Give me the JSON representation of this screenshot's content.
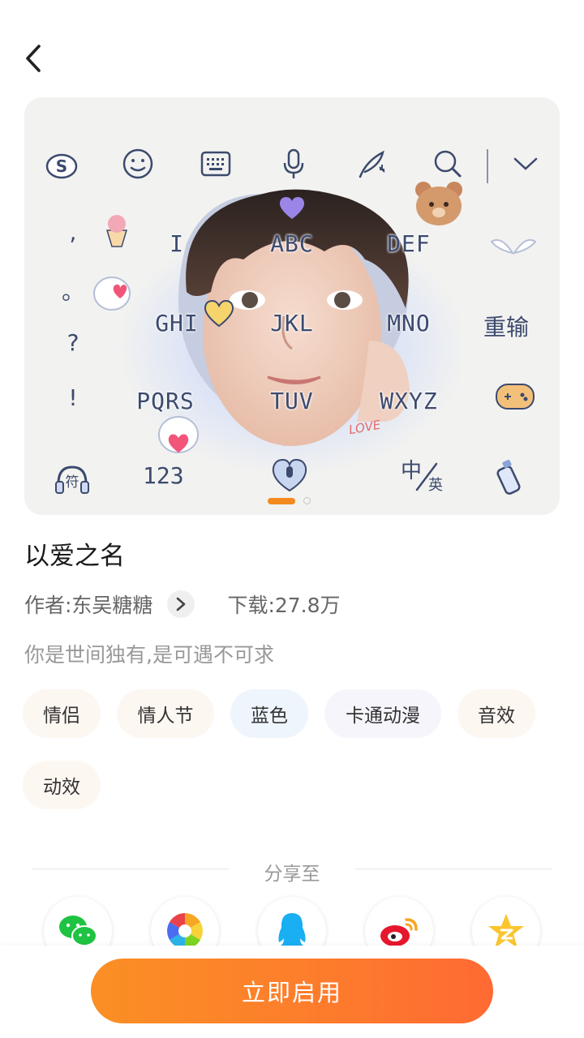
{
  "header": {
    "back_icon": "chevron-left-icon"
  },
  "preview": {
    "keys": {
      "row1": [
        "I",
        "ABC",
        "DEF"
      ],
      "row2": [
        "GHI",
        "JKL",
        "MNO"
      ],
      "row3": [
        "PQRS",
        "TUV",
        "WXYZ"
      ],
      "left_symbols": [
        ",",
        "。",
        "?",
        "!"
      ],
      "right_action": "重输",
      "bottom_num": "123",
      "symbol_key": "符",
      "lang_zh": "中",
      "lang_en": "英",
      "couple_sticker": "LOVE"
    },
    "toolbar_icons": [
      "sogou-logo-icon",
      "emoji-icon",
      "keyboard-icon",
      "microphone-icon",
      "feather-pen-icon",
      "search-icon",
      "collapse-chevron-icon"
    ],
    "carousel": {
      "count": 2,
      "active": 0
    }
  },
  "skin": {
    "title": "以爱之名",
    "author_label": "作者:东吴糖糖",
    "downloads_label": "下载:27.8万",
    "description": "你是世间独有,是可遇不可求"
  },
  "tags": [
    {
      "label": "情侣",
      "bg": "#fdf7f2"
    },
    {
      "label": "情人节",
      "bg": "#fdf7f2"
    },
    {
      "label": "蓝色",
      "bg": "#eef5fd"
    },
    {
      "label": "卡通动漫",
      "bg": "#f6f5fc"
    },
    {
      "label": "音效",
      "bg": "#fdf7f2"
    },
    {
      "label": "动效",
      "bg": "#fdf7f2"
    }
  ],
  "share": {
    "label": "分享至",
    "targets": [
      "wechat-icon",
      "moments-icon",
      "qq-icon",
      "weibo-icon",
      "qzone-icon"
    ]
  },
  "action": {
    "enable_label": "立即启用",
    "accent": "#fb8a22"
  }
}
